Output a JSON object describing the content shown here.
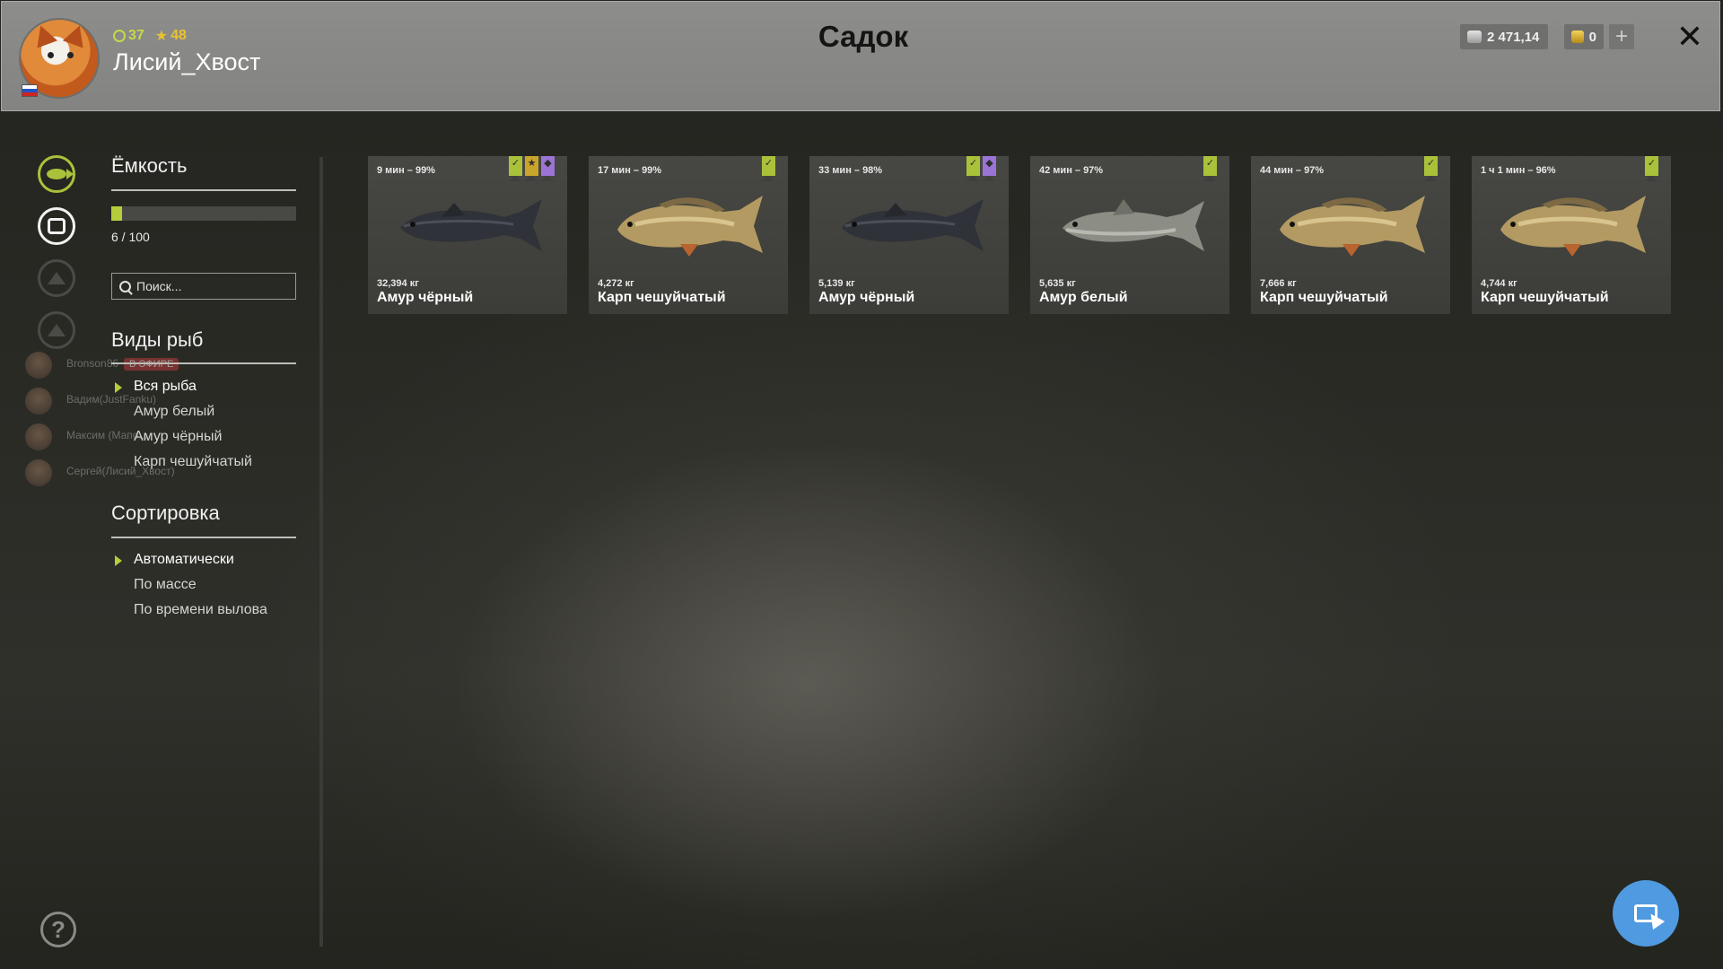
{
  "header": {
    "title": "Садок",
    "player": {
      "name": "Лисий_Хвост",
      "level": "37",
      "stars": "48"
    },
    "silver": "2 471,14",
    "gold": "0"
  },
  "capacity": {
    "title": "Ёмкость",
    "value": "6 / 100",
    "fraction": 0.06
  },
  "search": {
    "placeholder": "Поиск..."
  },
  "species": {
    "title": "Виды рыб",
    "items": [
      "Вся рыба",
      "Амур белый",
      "Амур чёрный",
      "Карп чешуйчатый"
    ],
    "selected": 0
  },
  "sorting": {
    "title": "Сортировка",
    "items": [
      "Автоматически",
      "По массе",
      "По времени вылова"
    ],
    "selected": 0
  },
  "stream": [
    {
      "name": "Bronson86",
      "tag": "В ЭФИРЕ"
    },
    {
      "name": "Вадим(JustFanku)",
      "tag": ""
    },
    {
      "name": "Максим (Мапо...",
      "tag": ""
    },
    {
      "name": "Сергей(Лисий_Хвост)",
      "tag": ""
    }
  ],
  "fish": [
    {
      "time": "9 мин – 99%",
      "weight": "32,394 кг",
      "name": "Амур чёрный",
      "kind": "black-amur",
      "badges": [
        "green",
        "star",
        "purple"
      ]
    },
    {
      "time": "17 мин – 99%",
      "weight": "4,272 кг",
      "name": "Карп чешуйчатый",
      "kind": "carp",
      "badges": [
        "green"
      ]
    },
    {
      "time": "33 мин – 98%",
      "weight": "5,139 кг",
      "name": "Амур чёрный",
      "kind": "black-amur",
      "badges": [
        "green",
        "purple"
      ]
    },
    {
      "time": "42 мин – 97%",
      "weight": "5,635 кг",
      "name": "Амур белый",
      "kind": "white-amur",
      "badges": [
        "green"
      ]
    },
    {
      "time": "44 мин – 97%",
      "weight": "7,666 кг",
      "name": "Карп чешуйчатый",
      "kind": "carp",
      "badges": [
        "green"
      ]
    },
    {
      "time": "1 ч 1 мин – 96%",
      "weight": "4,744 кг",
      "name": "Карп чешуйчатый",
      "kind": "carp",
      "badges": [
        "green"
      ]
    }
  ],
  "colors": {
    "accent": "#b7cc3a",
    "purple": "#9b74d6",
    "gold": "#c9a52b",
    "action": "#4f9ae0"
  }
}
